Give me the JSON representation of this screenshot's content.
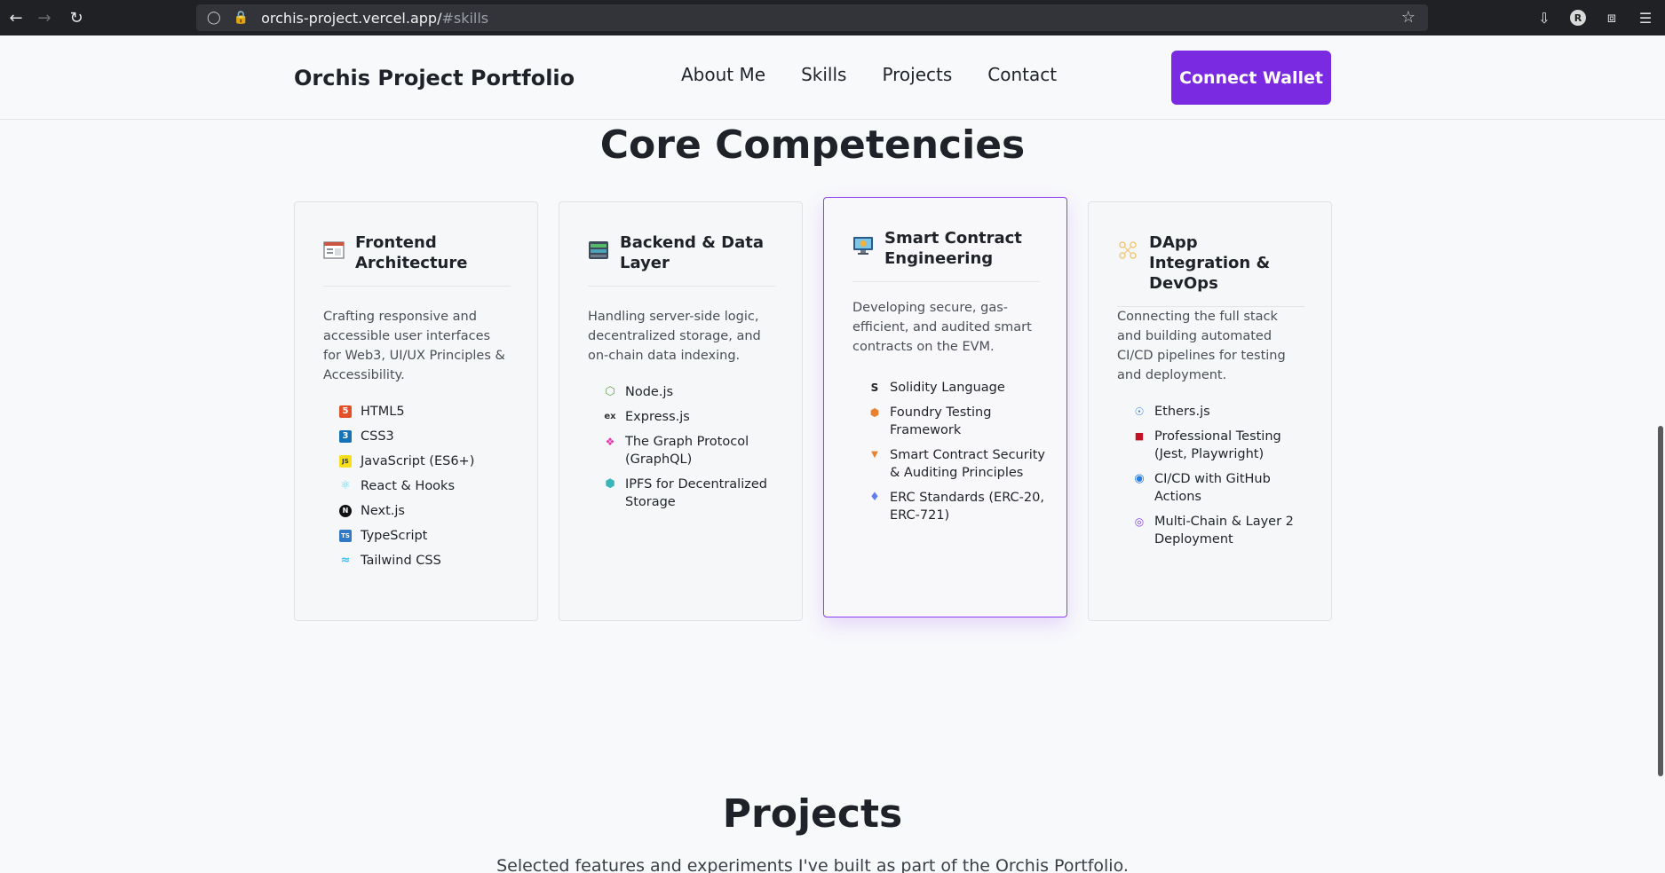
{
  "browser": {
    "url_host": "orchis-project.vercel.app/",
    "url_hash": "#skills",
    "profile_initial": "R"
  },
  "header": {
    "brand": "Orchis Project Portfolio",
    "nav": [
      "About Me",
      "Skills",
      "Projects",
      "Contact"
    ],
    "connect_label": "Connect Wallet",
    "accent": "#7a2be2"
  },
  "skills_section": {
    "title": "Core Competencies",
    "cards": [
      {
        "title": "Frontend Architecture",
        "description": "Crafting responsive and accessible user interfaces for Web3, UI/UX Principles & Accessibility.",
        "items": [
          {
            "label": "HTML5",
            "icon": "html5-icon"
          },
          {
            "label": "CSS3",
            "icon": "css3-icon"
          },
          {
            "label": "JavaScript (ES6+)",
            "icon": "javascript-icon"
          },
          {
            "label": "React & Hooks",
            "icon": "react-icon"
          },
          {
            "label": "Next.js",
            "icon": "nextjs-icon"
          },
          {
            "label": "TypeScript",
            "icon": "typescript-icon"
          },
          {
            "label": "Tailwind CSS",
            "icon": "tailwind-icon"
          }
        ]
      },
      {
        "title": "Backend & Data Layer",
        "description": "Handling server-side logic, decentralized storage, and on-chain data indexing.",
        "items": [
          {
            "label": "Node.js",
            "icon": "nodejs-icon"
          },
          {
            "label": "Express.js",
            "icon": "express-icon"
          },
          {
            "label": "The Graph Protocol (GraphQL)",
            "icon": "graph-icon"
          },
          {
            "label": "IPFS for Decentralized Storage",
            "icon": "ipfs-icon"
          }
        ]
      },
      {
        "title": "Smart Contract Engineering",
        "description": "Developing secure, gas-efficient, and audited smart contracts on the EVM.",
        "items": [
          {
            "label": "Solidity Language",
            "icon": "solidity-icon"
          },
          {
            "label": "Foundry Testing Framework",
            "icon": "foundry-icon"
          },
          {
            "label": "Smart Contract Security & Auditing Principles",
            "icon": "security-icon"
          },
          {
            "label": "ERC Standards (ERC-20, ERC-721)",
            "icon": "ethereum-icon"
          }
        ]
      },
      {
        "title": "DApp Integration & DevOps",
        "description": "Connecting the full stack and building automated CI/CD pipelines for testing and deployment.",
        "items": [
          {
            "label": "Ethers.js",
            "icon": "ethers-icon"
          },
          {
            "label": "Professional Testing (Jest, Playwright)",
            "icon": "testing-icon"
          },
          {
            "label": "CI/CD with GitHub Actions",
            "icon": "github-icon"
          },
          {
            "label": "Multi-Chain & Layer 2 Deployment",
            "icon": "multichain-icon"
          }
        ]
      }
    ]
  },
  "projects_section": {
    "title": "Projects",
    "subtitle": "Selected features and experiments I've built as part of the Orchis Portfolio."
  }
}
